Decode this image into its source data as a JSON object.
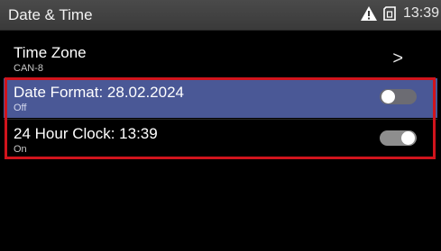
{
  "statusbar": {
    "title": "Date & Time",
    "time": "13:39",
    "icons": [
      "warning-icon",
      "sim-card-icon"
    ]
  },
  "settings": {
    "time_zone": {
      "label": "Time Zone",
      "value": "CAN-8",
      "chevron": ">"
    },
    "date_format": {
      "label": "Date Format: 28.02.2024",
      "state": "Off",
      "enabled": false
    },
    "hour_clock": {
      "label": "24 Hour Clock: 13:39",
      "state": "On",
      "enabled": true
    }
  },
  "colors": {
    "selected_row": "#4a5896",
    "highlight_border": "#d0141c",
    "statusbar_bg": "#3f3f3f"
  }
}
